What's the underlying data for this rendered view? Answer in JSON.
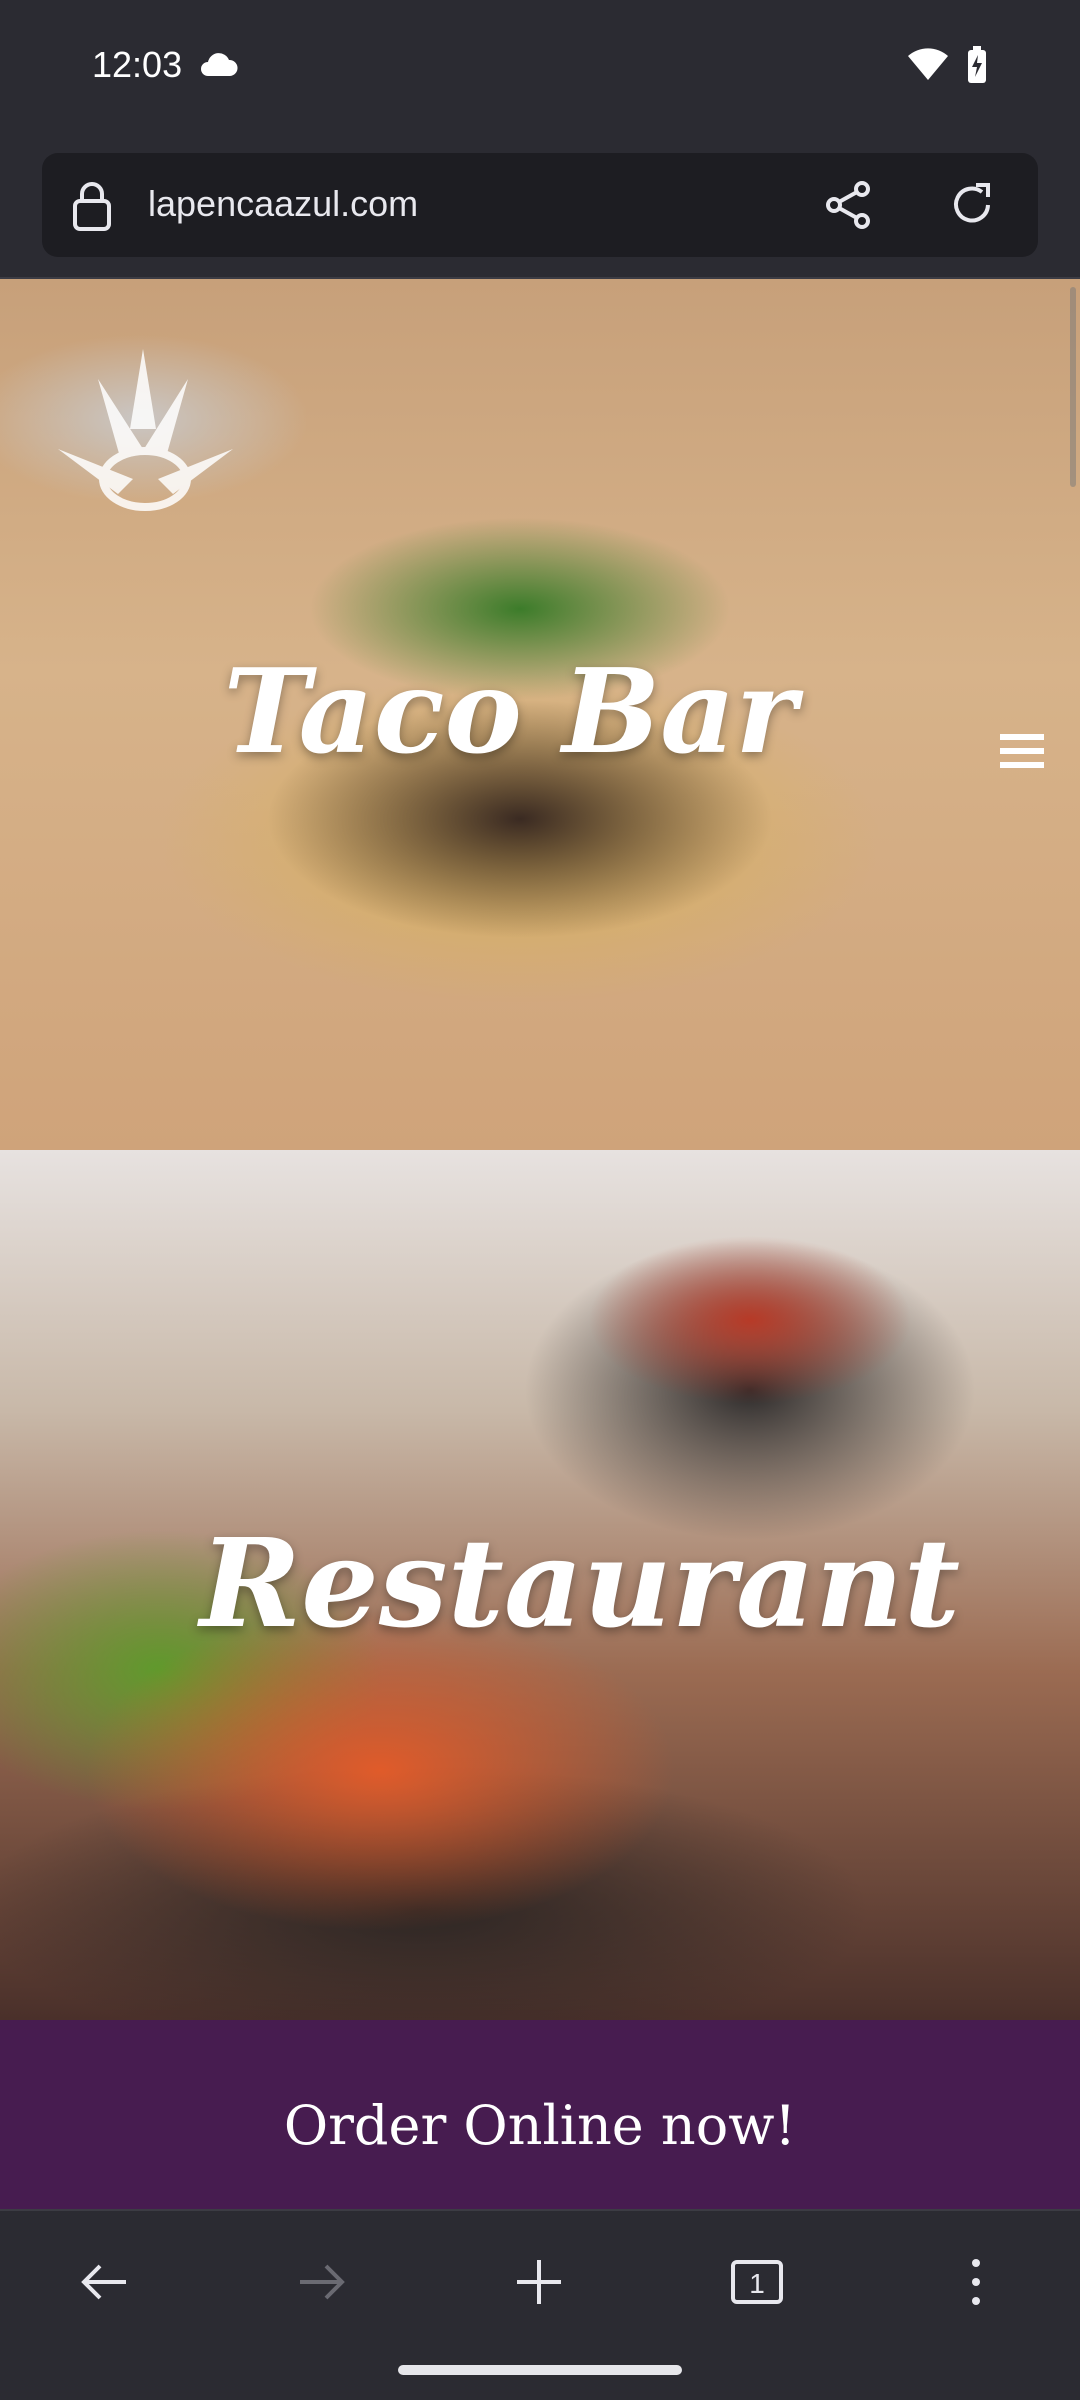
{
  "status_bar": {
    "time": "12:03",
    "icons": [
      "cloud-icon",
      "wifi-icon",
      "battery-charging-icon"
    ]
  },
  "browser": {
    "url": "lapencaazul.com",
    "icons": [
      "lock-icon",
      "share-icon",
      "reload-icon"
    ]
  },
  "page": {
    "hero1_title": "Taco Bar",
    "hero2_title": "Restaurant",
    "order_text": "Order Online now!",
    "order_band_color": "#471c50",
    "menu_icon": "hamburger-menu-icon",
    "logo": "agave-logo"
  },
  "bottom_nav": {
    "items": [
      "back-arrow-icon",
      "forward-arrow-icon",
      "new-tab-plus-icon",
      "tab-count-icon",
      "more-vert-icon"
    ],
    "tab_count": "1"
  }
}
